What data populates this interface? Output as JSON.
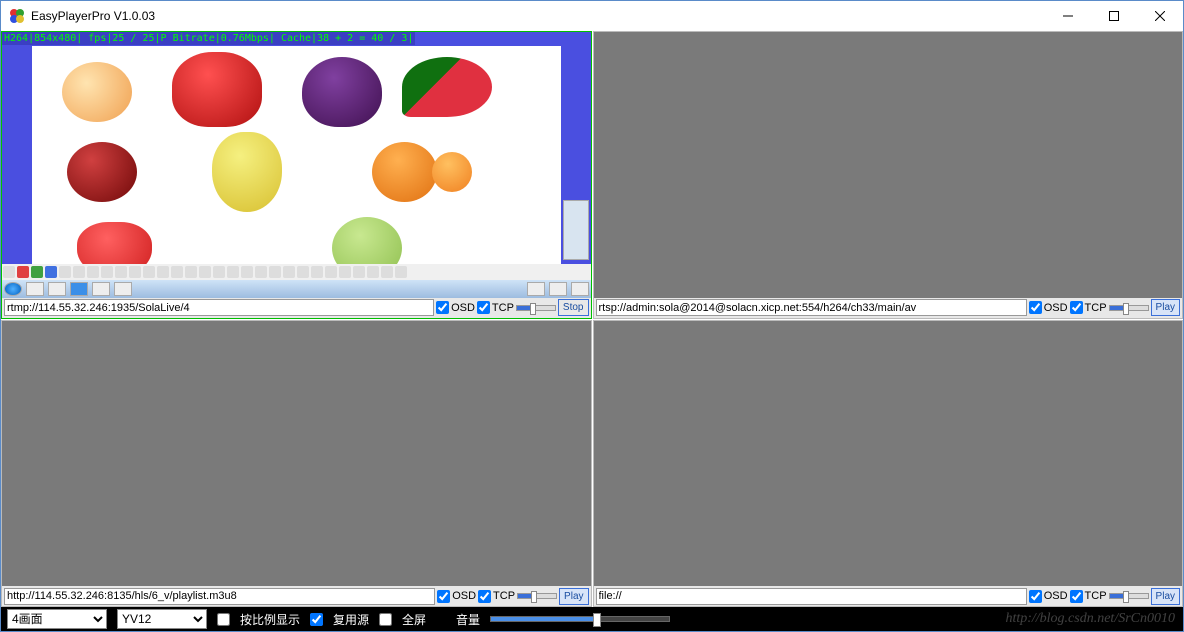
{
  "window": {
    "title": "EasyPlayerPro V1.0.03"
  },
  "panels": [
    {
      "url": "rtmp://114.55.32.246:1935/SolaLive/4",
      "osd": true,
      "tcp": true,
      "action": "Stop",
      "overlay": "H264|854x480| fps|25 / 25|P Bitrate|0.76Mbps| Cache|38 + 2 = 40 / 3|"
    },
    {
      "url": "rtsp://admin:sola@2014@solacn.xicp.net:554/h264/ch33/main/av",
      "osd": true,
      "tcp": true,
      "action": "Play",
      "overlay": ""
    },
    {
      "url": "http://114.55.32.246:8135/hls/6_v/playlist.m3u8",
      "osd": true,
      "tcp": true,
      "action": "Play",
      "overlay": ""
    },
    {
      "url": "file://",
      "osd": true,
      "tcp": true,
      "action": "Play",
      "overlay": ""
    }
  ],
  "labels": {
    "osd": "OSD",
    "tcp": "TCP"
  },
  "bottom": {
    "layout_options": [
      "4画面"
    ],
    "layout_selected": "4画面",
    "format_options": [
      "YV12"
    ],
    "format_selected": "YV12",
    "scale_label": "按比例显示",
    "scale_checked": false,
    "reuse_label": "复用源",
    "reuse_checked": true,
    "fullscreen_label": "全屏",
    "fullscreen_checked": false,
    "volume_label": "音量"
  },
  "watermark": "http://blog.csdn.net/SrCn0010"
}
